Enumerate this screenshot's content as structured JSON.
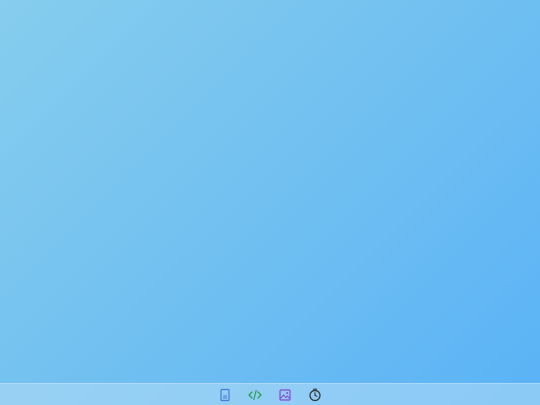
{
  "desktop": {
    "background_gradient": [
      "#86cdee",
      "#5ab3f6"
    ]
  },
  "taskbar": {
    "apps": [
      {
        "name": "document-icon",
        "color": "#4a7bd6"
      },
      {
        "name": "code-icon",
        "color": "#2f9e58"
      },
      {
        "name": "image-icon",
        "color": "#8b4ad6"
      },
      {
        "name": "clock-icon",
        "color": "#333333"
      }
    ]
  }
}
